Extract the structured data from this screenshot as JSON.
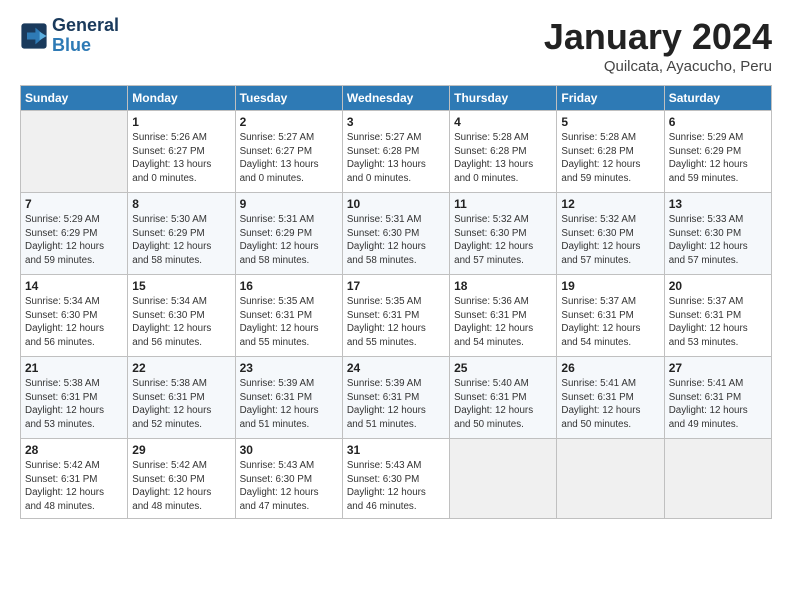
{
  "logo": {
    "line1": "General",
    "line2": "Blue"
  },
  "title": "January 2024",
  "location": "Quilcata, Ayacucho, Peru",
  "days_of_week": [
    "Sunday",
    "Monday",
    "Tuesday",
    "Wednesday",
    "Thursday",
    "Friday",
    "Saturday"
  ],
  "weeks": [
    [
      {
        "num": "",
        "info": ""
      },
      {
        "num": "1",
        "info": "Sunrise: 5:26 AM\nSunset: 6:27 PM\nDaylight: 13 hours\nand 0 minutes."
      },
      {
        "num": "2",
        "info": "Sunrise: 5:27 AM\nSunset: 6:27 PM\nDaylight: 13 hours\nand 0 minutes."
      },
      {
        "num": "3",
        "info": "Sunrise: 5:27 AM\nSunset: 6:28 PM\nDaylight: 13 hours\nand 0 minutes."
      },
      {
        "num": "4",
        "info": "Sunrise: 5:28 AM\nSunset: 6:28 PM\nDaylight: 13 hours\nand 0 minutes."
      },
      {
        "num": "5",
        "info": "Sunrise: 5:28 AM\nSunset: 6:28 PM\nDaylight: 12 hours\nand 59 minutes."
      },
      {
        "num": "6",
        "info": "Sunrise: 5:29 AM\nSunset: 6:29 PM\nDaylight: 12 hours\nand 59 minutes."
      }
    ],
    [
      {
        "num": "7",
        "info": "Sunrise: 5:29 AM\nSunset: 6:29 PM\nDaylight: 12 hours\nand 59 minutes."
      },
      {
        "num": "8",
        "info": "Sunrise: 5:30 AM\nSunset: 6:29 PM\nDaylight: 12 hours\nand 58 minutes."
      },
      {
        "num": "9",
        "info": "Sunrise: 5:31 AM\nSunset: 6:29 PM\nDaylight: 12 hours\nand 58 minutes."
      },
      {
        "num": "10",
        "info": "Sunrise: 5:31 AM\nSunset: 6:30 PM\nDaylight: 12 hours\nand 58 minutes."
      },
      {
        "num": "11",
        "info": "Sunrise: 5:32 AM\nSunset: 6:30 PM\nDaylight: 12 hours\nand 57 minutes."
      },
      {
        "num": "12",
        "info": "Sunrise: 5:32 AM\nSunset: 6:30 PM\nDaylight: 12 hours\nand 57 minutes."
      },
      {
        "num": "13",
        "info": "Sunrise: 5:33 AM\nSunset: 6:30 PM\nDaylight: 12 hours\nand 57 minutes."
      }
    ],
    [
      {
        "num": "14",
        "info": "Sunrise: 5:34 AM\nSunset: 6:30 PM\nDaylight: 12 hours\nand 56 minutes."
      },
      {
        "num": "15",
        "info": "Sunrise: 5:34 AM\nSunset: 6:30 PM\nDaylight: 12 hours\nand 56 minutes."
      },
      {
        "num": "16",
        "info": "Sunrise: 5:35 AM\nSunset: 6:31 PM\nDaylight: 12 hours\nand 55 minutes."
      },
      {
        "num": "17",
        "info": "Sunrise: 5:35 AM\nSunset: 6:31 PM\nDaylight: 12 hours\nand 55 minutes."
      },
      {
        "num": "18",
        "info": "Sunrise: 5:36 AM\nSunset: 6:31 PM\nDaylight: 12 hours\nand 54 minutes."
      },
      {
        "num": "19",
        "info": "Sunrise: 5:37 AM\nSunset: 6:31 PM\nDaylight: 12 hours\nand 54 minutes."
      },
      {
        "num": "20",
        "info": "Sunrise: 5:37 AM\nSunset: 6:31 PM\nDaylight: 12 hours\nand 53 minutes."
      }
    ],
    [
      {
        "num": "21",
        "info": "Sunrise: 5:38 AM\nSunset: 6:31 PM\nDaylight: 12 hours\nand 53 minutes."
      },
      {
        "num": "22",
        "info": "Sunrise: 5:38 AM\nSunset: 6:31 PM\nDaylight: 12 hours\nand 52 minutes."
      },
      {
        "num": "23",
        "info": "Sunrise: 5:39 AM\nSunset: 6:31 PM\nDaylight: 12 hours\nand 51 minutes."
      },
      {
        "num": "24",
        "info": "Sunrise: 5:39 AM\nSunset: 6:31 PM\nDaylight: 12 hours\nand 51 minutes."
      },
      {
        "num": "25",
        "info": "Sunrise: 5:40 AM\nSunset: 6:31 PM\nDaylight: 12 hours\nand 50 minutes."
      },
      {
        "num": "26",
        "info": "Sunrise: 5:41 AM\nSunset: 6:31 PM\nDaylight: 12 hours\nand 50 minutes."
      },
      {
        "num": "27",
        "info": "Sunrise: 5:41 AM\nSunset: 6:31 PM\nDaylight: 12 hours\nand 49 minutes."
      }
    ],
    [
      {
        "num": "28",
        "info": "Sunrise: 5:42 AM\nSunset: 6:31 PM\nDaylight: 12 hours\nand 48 minutes."
      },
      {
        "num": "29",
        "info": "Sunrise: 5:42 AM\nSunset: 6:30 PM\nDaylight: 12 hours\nand 48 minutes."
      },
      {
        "num": "30",
        "info": "Sunrise: 5:43 AM\nSunset: 6:30 PM\nDaylight: 12 hours\nand 47 minutes."
      },
      {
        "num": "31",
        "info": "Sunrise: 5:43 AM\nSunset: 6:30 PM\nDaylight: 12 hours\nand 46 minutes."
      },
      {
        "num": "",
        "info": ""
      },
      {
        "num": "",
        "info": ""
      },
      {
        "num": "",
        "info": ""
      }
    ]
  ]
}
